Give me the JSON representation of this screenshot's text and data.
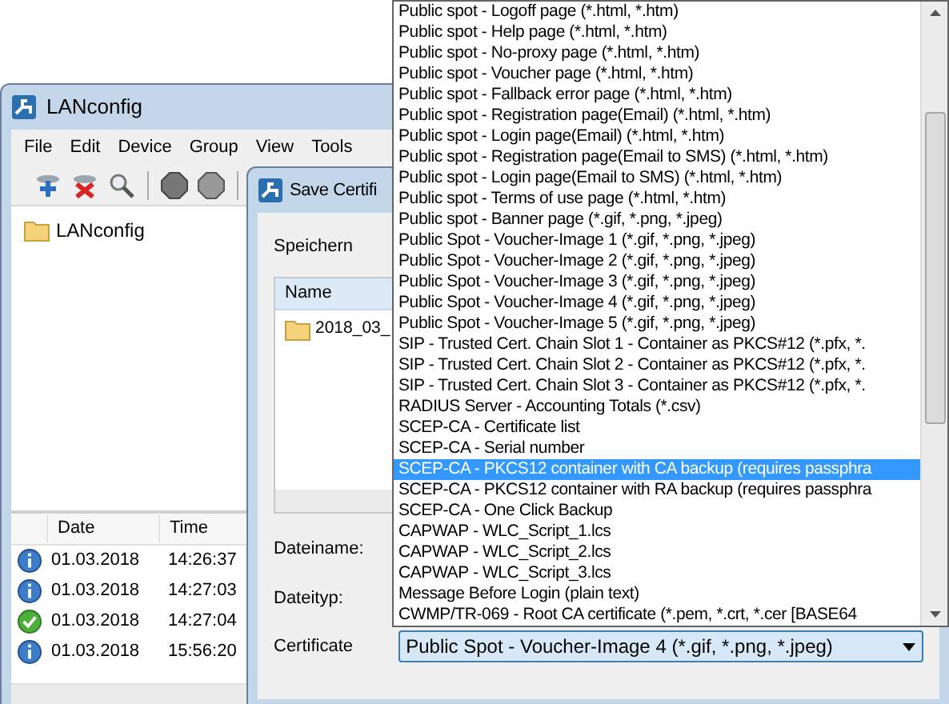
{
  "main_window": {
    "title": "LANconfig",
    "menu": [
      "File",
      "Edit",
      "Device",
      "Group",
      "View",
      "Tools"
    ],
    "tree": [
      {
        "label": "LANconfig"
      }
    ],
    "log": {
      "columns": [
        "Date",
        "Time"
      ],
      "rows": [
        {
          "kind": "info",
          "date": "01.03.2018",
          "time": "14:26:37"
        },
        {
          "kind": "info",
          "date": "01.03.2018",
          "time": "14:27:03"
        },
        {
          "kind": "success",
          "date": "01.03.2018",
          "time": "14:27:04"
        },
        {
          "kind": "info",
          "date": "01.03.2018",
          "time": "15:56:20"
        }
      ]
    }
  },
  "dialog": {
    "title": "Save Certifi",
    "save_in_label": "Speichern",
    "list": {
      "columns": [
        "Name"
      ],
      "rows": [
        "2018_03_"
      ]
    },
    "filename_label": "Dateiname:",
    "filetype_label": "Dateityp:",
    "certificate_label": "Certificate",
    "certificate_value": "Public Spot - Voucher-Image 4 (*.gif, *.png, *.jpeg)",
    "dropdown": {
      "options": [
        {
          "label": "Public spot - Logoff page (*.html, *.htm)",
          "selected": false
        },
        {
          "label": "Public spot - Help page (*.html, *.htm)",
          "selected": false
        },
        {
          "label": "Public spot - No-proxy page (*.html, *.htm)",
          "selected": false
        },
        {
          "label": "Public spot - Voucher page (*.html, *.htm)",
          "selected": false
        },
        {
          "label": "Public spot - Fallback error page (*.html, *.htm)",
          "selected": false
        },
        {
          "label": "Public spot - Registration page(Email) (*.html, *.htm)",
          "selected": false
        },
        {
          "label": "Public spot - Login page(Email) (*.html, *.htm)",
          "selected": false
        },
        {
          "label": "Public spot - Registration page(Email to SMS) (*.html, *.htm)",
          "selected": false
        },
        {
          "label": "Public spot - Login page(Email to SMS) (*.html, *.htm)",
          "selected": false
        },
        {
          "label": "Public spot - Terms of use page (*.html, *.htm)",
          "selected": false
        },
        {
          "label": "Public spot - Banner page (*.gif, *.png, *.jpeg)",
          "selected": false
        },
        {
          "label": "Public Spot - Voucher-Image 1 (*.gif, *.png, *.jpeg)",
          "selected": false
        },
        {
          "label": "Public Spot - Voucher-Image 2 (*.gif, *.png, *.jpeg)",
          "selected": false
        },
        {
          "label": "Public Spot - Voucher-Image 3 (*.gif, *.png, *.jpeg)",
          "selected": false
        },
        {
          "label": "Public Spot - Voucher-Image 4 (*.gif, *.png, *.jpeg)",
          "selected": false
        },
        {
          "label": "Public Spot - Voucher-Image 5 (*.gif, *.png, *.jpeg)",
          "selected": false
        },
        {
          "label": "SIP - Trusted Cert. Chain Slot 1 - Container as PKCS#12 (*.pfx, *.",
          "selected": false
        },
        {
          "label": "SIP - Trusted Cert. Chain Slot 2 - Container as PKCS#12 (*.pfx, *.",
          "selected": false
        },
        {
          "label": "SIP - Trusted Cert. Chain Slot 3 - Container as PKCS#12 (*.pfx, *.",
          "selected": false
        },
        {
          "label": "RADIUS Server - Accounting Totals (*.csv)",
          "selected": false
        },
        {
          "label": "SCEP-CA - Certificate list",
          "selected": false
        },
        {
          "label": "SCEP-CA - Serial number",
          "selected": false
        },
        {
          "label": "SCEP-CA - PKCS12 container with CA backup (requires passphra",
          "selected": true
        },
        {
          "label": "SCEP-CA - PKCS12 container with RA backup (requires passphra",
          "selected": false
        },
        {
          "label": "SCEP-CA - One Click Backup",
          "selected": false
        },
        {
          "label": "CAPWAP - WLC_Script_1.lcs",
          "selected": false
        },
        {
          "label": "CAPWAP - WLC_Script_2.lcs",
          "selected": false
        },
        {
          "label": "CAPWAP - WLC_Script_3.lcs",
          "selected": false
        },
        {
          "label": "Message Before Login (plain text)",
          "selected": false
        },
        {
          "label": "CWMP/TR-069 - Root CA certificate (*.pem, *.crt, *.cer [BASE64",
          "selected": false
        }
      ]
    }
  }
}
